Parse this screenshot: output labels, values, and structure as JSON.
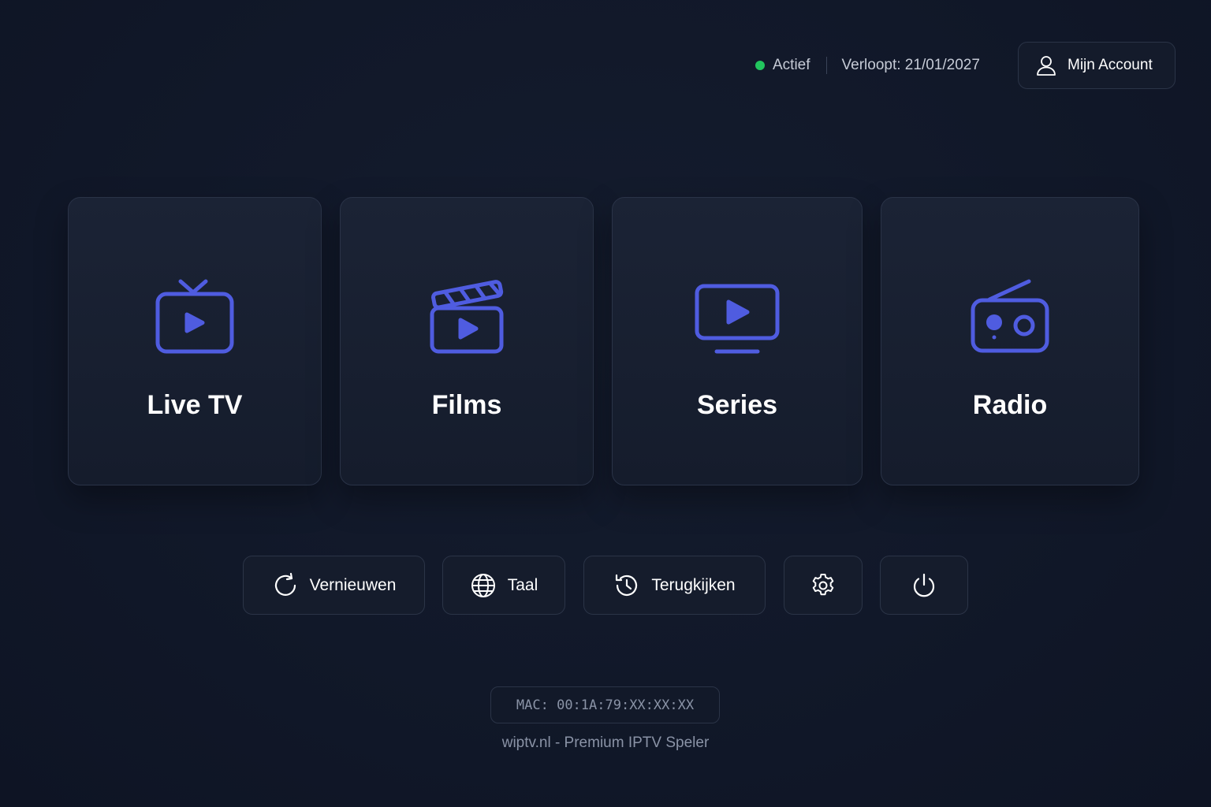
{
  "header": {
    "status_label": "Actief",
    "status_color": "#22c55e",
    "expiry_text": "Verloopt: 21/01/2027",
    "account_label": "Mijn Account"
  },
  "tiles": [
    {
      "label": "Live TV",
      "icon": "live-tv-icon"
    },
    {
      "label": "Films",
      "icon": "clapperboard-icon"
    },
    {
      "label": "Series",
      "icon": "monitor-play-icon"
    },
    {
      "label": "Radio",
      "icon": "radio-icon"
    }
  ],
  "actions": [
    {
      "label": "Vernieuwen",
      "icon": "refresh-icon"
    },
    {
      "label": "Taal",
      "icon": "globe-icon"
    },
    {
      "label": "Terugkijken",
      "icon": "history-icon"
    },
    {
      "label": "",
      "icon": "gear-icon"
    },
    {
      "label": "",
      "icon": "power-icon"
    }
  ],
  "footer": {
    "mac": "MAC: 00:1A:79:XX:XX:XX",
    "tagline": "wiptv.nl - Premium IPTV Speler"
  },
  "colors": {
    "accent": "#4f5ce0",
    "background": "#111829"
  }
}
